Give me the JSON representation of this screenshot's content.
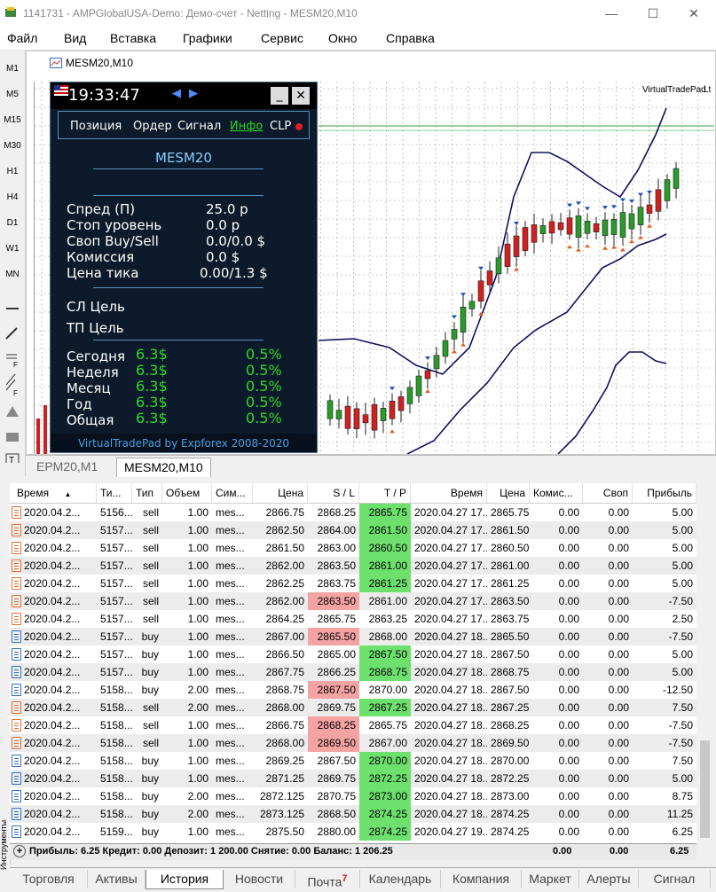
{
  "window": {
    "title": "1141731 - AMPGlobalUSA-Demo: Демо-счет - Netting - MESM20,M10"
  },
  "menu": [
    "Файл",
    "Вид",
    "Вставка",
    "Графики",
    "Сервис",
    "Окно",
    "Справка"
  ],
  "timeframes": [
    "M1",
    "M5",
    "M15",
    "M30",
    "H1",
    "H4",
    "D1",
    "W1",
    "MN"
  ],
  "chart": {
    "tab_title": "MESM20,M10",
    "indicator_label": "VirtualTradePad",
    "indicator_label2": "Lt"
  },
  "panel": {
    "time": "19:33:47",
    "tabs": [
      "Позиция",
      "Ордер",
      "Сигнал",
      "Инфо",
      "CLP"
    ],
    "symbol": "MESM20",
    "info_rows": [
      {
        "label": "Спред (П)",
        "value": "25.0 р"
      },
      {
        "label": "Стоп уровень",
        "value": "0.0 р"
      },
      {
        "label": "Своп Buy/Sell",
        "value": "0.0/0.0 $"
      },
      {
        "label": "Комиссия",
        "value": "0.0 $"
      },
      {
        "label": "Цена тика",
        "value": "0.00/1.3 $"
      }
    ],
    "sl_label": "СЛ Цель",
    "tp_label": "ТП Цель",
    "stats": [
      {
        "label": "Сегодня",
        "value": "6.3$",
        "pct": "0.5%"
      },
      {
        "label": "Неделя",
        "value": "6.3$",
        "pct": "0.5%"
      },
      {
        "label": "Месяц",
        "value": "6.3$",
        "pct": "0.5%"
      },
      {
        "label": "Год",
        "value": "6.3$",
        "pct": "0.5%"
      },
      {
        "label": "Общая",
        "value": "6.3$",
        "pct": "0.5%"
      }
    ],
    "footer": "VirtualTradePad by Expforex 2008-2020"
  },
  "chart_tabs": [
    "EPM20,M1",
    "MESM20,M10"
  ],
  "table": {
    "headers": [
      "Время",
      "Ти...",
      "Тип",
      "Объем",
      "Сим...",
      "Цена",
      "S / L",
      "T / P",
      "Время",
      "Цена",
      "Комис...",
      "Своп",
      "Прибыль"
    ],
    "rows": [
      {
        "time": "2020.04.2...",
        "ticket": "5156...",
        "type": "sell",
        "vol": "1.00",
        "sym": "mes...",
        "price": "2866.75",
        "sl": "2868.25",
        "tp": "2865.75",
        "ctime": "2020.04.27 17...",
        "cprice": "2865.75",
        "comm": "0.00",
        "swap": "0.00",
        "profit": "5.00",
        "hl": "tp"
      },
      {
        "time": "2020.04.2...",
        "ticket": "5157...",
        "type": "sell",
        "vol": "1.00",
        "sym": "mes...",
        "price": "2862.50",
        "sl": "2864.00",
        "tp": "2861.50",
        "ctime": "2020.04.27 17...",
        "cprice": "2861.50",
        "comm": "0.00",
        "swap": "0.00",
        "profit": "5.00",
        "hl": "tp"
      },
      {
        "time": "2020.04.2...",
        "ticket": "5157...",
        "type": "sell",
        "vol": "1.00",
        "sym": "mes...",
        "price": "2861.50",
        "sl": "2863.00",
        "tp": "2860.50",
        "ctime": "2020.04.27 17...",
        "cprice": "2860.50",
        "comm": "0.00",
        "swap": "0.00",
        "profit": "5.00",
        "hl": "tp"
      },
      {
        "time": "2020.04.2...",
        "ticket": "5157...",
        "type": "sell",
        "vol": "1.00",
        "sym": "mes...",
        "price": "2862.00",
        "sl": "2863.50",
        "tp": "2861.00",
        "ctime": "2020.04.27 17...",
        "cprice": "2861.00",
        "comm": "0.00",
        "swap": "0.00",
        "profit": "5.00",
        "hl": "tp"
      },
      {
        "time": "2020.04.2...",
        "ticket": "5157...",
        "type": "sell",
        "vol": "1.00",
        "sym": "mes...",
        "price": "2862.25",
        "sl": "2863.75",
        "tp": "2861.25",
        "ctime": "2020.04.27 17...",
        "cprice": "2861.25",
        "comm": "0.00",
        "swap": "0.00",
        "profit": "5.00",
        "hl": "tp"
      },
      {
        "time": "2020.04.2...",
        "ticket": "5157...",
        "type": "sell",
        "vol": "1.00",
        "sym": "mes...",
        "price": "2862.00",
        "sl": "2863.50",
        "tp": "2861.00",
        "ctime": "2020.04.27 17...",
        "cprice": "2863.50",
        "comm": "0.00",
        "swap": "0.00",
        "profit": "-7.50",
        "hl": "sl"
      },
      {
        "time": "2020.04.2...",
        "ticket": "5157...",
        "type": "sell",
        "vol": "1.00",
        "sym": "mes...",
        "price": "2864.25",
        "sl": "2865.75",
        "tp": "2863.25",
        "ctime": "2020.04.27 17...",
        "cprice": "2863.75",
        "comm": "0.00",
        "swap": "0.00",
        "profit": "2.50",
        "hl": ""
      },
      {
        "time": "2020.04.2...",
        "ticket": "5157...",
        "type": "buy",
        "vol": "1.00",
        "sym": "mes...",
        "price": "2867.00",
        "sl": "2865.50",
        "tp": "2868.00",
        "ctime": "2020.04.27 18...",
        "cprice": "2865.50",
        "comm": "0.00",
        "swap": "0.00",
        "profit": "-7.50",
        "hl": "sl"
      },
      {
        "time": "2020.04.2...",
        "ticket": "5157...",
        "type": "buy",
        "vol": "1.00",
        "sym": "mes...",
        "price": "2866.50",
        "sl": "2865.00",
        "tp": "2867.50",
        "ctime": "2020.04.27 18...",
        "cprice": "2867.50",
        "comm": "0.00",
        "swap": "0.00",
        "profit": "5.00",
        "hl": "tp"
      },
      {
        "time": "2020.04.2...",
        "ticket": "5157...",
        "type": "buy",
        "vol": "1.00",
        "sym": "mes...",
        "price": "2867.75",
        "sl": "2866.25",
        "tp": "2868.75",
        "ctime": "2020.04.27 18...",
        "cprice": "2868.75",
        "comm": "0.00",
        "swap": "0.00",
        "profit": "5.00",
        "hl": "tp"
      },
      {
        "time": "2020.04.2...",
        "ticket": "5158...",
        "type": "buy",
        "vol": "2.00",
        "sym": "mes...",
        "price": "2868.75",
        "sl": "2867.50",
        "tp": "2870.00",
        "ctime": "2020.04.27 18...",
        "cprice": "2867.50",
        "comm": "0.00",
        "swap": "0.00",
        "profit": "-12.50",
        "hl": "sl"
      },
      {
        "time": "2020.04.2...",
        "ticket": "5158...",
        "type": "sell",
        "vol": "2.00",
        "sym": "mes...",
        "price": "2868.00",
        "sl": "2869.75",
        "tp": "2867.25",
        "ctime": "2020.04.27 18...",
        "cprice": "2867.25",
        "comm": "0.00",
        "swap": "0.00",
        "profit": "7.50",
        "hl": "tp"
      },
      {
        "time": "2020.04.2...",
        "ticket": "5158...",
        "type": "sell",
        "vol": "1.00",
        "sym": "mes...",
        "price": "2866.75",
        "sl": "2868.25",
        "tp": "2865.75",
        "ctime": "2020.04.27 18...",
        "cprice": "2868.25",
        "comm": "0.00",
        "swap": "0.00",
        "profit": "-7.50",
        "hl": "sl"
      },
      {
        "time": "2020.04.2...",
        "ticket": "5158...",
        "type": "sell",
        "vol": "1.00",
        "sym": "mes...",
        "price": "2868.00",
        "sl": "2869.50",
        "tp": "2867.00",
        "ctime": "2020.04.27 18...",
        "cprice": "2869.50",
        "comm": "0.00",
        "swap": "0.00",
        "profit": "-7.50",
        "hl": "sl"
      },
      {
        "time": "2020.04.2...",
        "ticket": "5158...",
        "type": "buy",
        "vol": "1.00",
        "sym": "mes...",
        "price": "2869.25",
        "sl": "2867.50",
        "tp": "2870.00",
        "ctime": "2020.04.27 18...",
        "cprice": "2870.00",
        "comm": "0.00",
        "swap": "0.00",
        "profit": "7.50",
        "hl": "tp"
      },
      {
        "time": "2020.04.2...",
        "ticket": "5158...",
        "type": "buy",
        "vol": "1.00",
        "sym": "mes...",
        "price": "2871.25",
        "sl": "2869.75",
        "tp": "2872.25",
        "ctime": "2020.04.27 18...",
        "cprice": "2872.25",
        "comm": "0.00",
        "swap": "0.00",
        "profit": "5.00",
        "hl": "tp"
      },
      {
        "time": "2020.04.2...",
        "ticket": "5158...",
        "type": "buy",
        "vol": "2.00",
        "sym": "mes...",
        "price": "2872.125",
        "sl": "2870.75",
        "tp": "2873.00",
        "ctime": "2020.04.27 18...",
        "cprice": "2873.00",
        "comm": "0.00",
        "swap": "0.00",
        "profit": "8.75",
        "hl": "tp"
      },
      {
        "time": "2020.04.2...",
        "ticket": "5158...",
        "type": "buy",
        "vol": "2.00",
        "sym": "mes...",
        "price": "2873.125",
        "sl": "2868.50",
        "tp": "2874.25",
        "ctime": "2020.04.27 18...",
        "cprice": "2874.25",
        "comm": "0.00",
        "swap": "0.00",
        "profit": "11.25",
        "hl": "tp"
      },
      {
        "time": "2020.04.2...",
        "ticket": "5159...",
        "type": "buy",
        "vol": "1.00",
        "sym": "mes...",
        "price": "2875.50",
        "sl": "2880.00",
        "tp": "2874.25",
        "ctime": "2020.04.27 19...",
        "cprice": "2874.25",
        "comm": "0.00",
        "swap": "0.00",
        "profit": "6.25",
        "hl": "tp"
      }
    ]
  },
  "summary": {
    "text": "Прибыль: 6.25  Кредит: 0.00  Депозит: 1 200.00  Снятие: 0.00  Баланс: 1 206.25",
    "comm": "0.00",
    "swap": "0.00",
    "profit": "6.25"
  },
  "bottom_tabs": [
    "Торговля",
    "Активы",
    "История",
    "Новости",
    "Почта",
    "Календарь",
    "Компания",
    "Маркет",
    "Алерты",
    "Сигнал"
  ],
  "mail_badge": "7",
  "sidebar_label": "Инструменты",
  "colors": {
    "panel_bg": "#0d1a2b",
    "panel_accent": "#2bd82b",
    "tp_green": "#6de06d",
    "sl_red": "#f4a3a3",
    "ma_line": "#101060",
    "bull": "#2a9a2a",
    "bear": "#d02020"
  }
}
